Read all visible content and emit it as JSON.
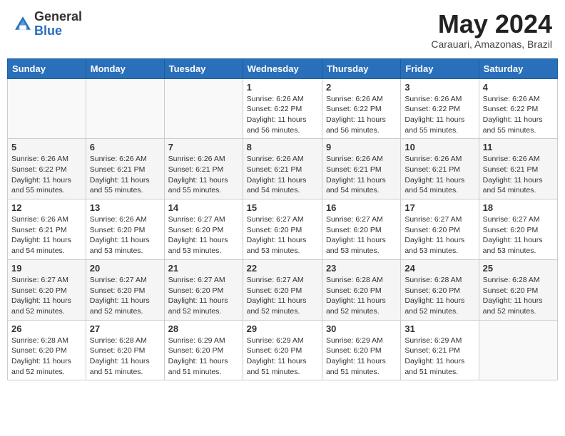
{
  "header": {
    "logo_general": "General",
    "logo_blue": "Blue",
    "month_title": "May 2024",
    "subtitle": "Carauari, Amazonas, Brazil"
  },
  "days_of_week": [
    "Sunday",
    "Monday",
    "Tuesday",
    "Wednesday",
    "Thursday",
    "Friday",
    "Saturday"
  ],
  "weeks": [
    [
      {
        "day": "",
        "sunrise": "",
        "sunset": "",
        "daylight": ""
      },
      {
        "day": "",
        "sunrise": "",
        "sunset": "",
        "daylight": ""
      },
      {
        "day": "",
        "sunrise": "",
        "sunset": "",
        "daylight": ""
      },
      {
        "day": "1",
        "sunrise": "Sunrise: 6:26 AM",
        "sunset": "Sunset: 6:22 PM",
        "daylight": "Daylight: 11 hours and 56 minutes."
      },
      {
        "day": "2",
        "sunrise": "Sunrise: 6:26 AM",
        "sunset": "Sunset: 6:22 PM",
        "daylight": "Daylight: 11 hours and 56 minutes."
      },
      {
        "day": "3",
        "sunrise": "Sunrise: 6:26 AM",
        "sunset": "Sunset: 6:22 PM",
        "daylight": "Daylight: 11 hours and 55 minutes."
      },
      {
        "day": "4",
        "sunrise": "Sunrise: 6:26 AM",
        "sunset": "Sunset: 6:22 PM",
        "daylight": "Daylight: 11 hours and 55 minutes."
      }
    ],
    [
      {
        "day": "5",
        "sunrise": "Sunrise: 6:26 AM",
        "sunset": "Sunset: 6:22 PM",
        "daylight": "Daylight: 11 hours and 55 minutes."
      },
      {
        "day": "6",
        "sunrise": "Sunrise: 6:26 AM",
        "sunset": "Sunset: 6:21 PM",
        "daylight": "Daylight: 11 hours and 55 minutes."
      },
      {
        "day": "7",
        "sunrise": "Sunrise: 6:26 AM",
        "sunset": "Sunset: 6:21 PM",
        "daylight": "Daylight: 11 hours and 55 minutes."
      },
      {
        "day": "8",
        "sunrise": "Sunrise: 6:26 AM",
        "sunset": "Sunset: 6:21 PM",
        "daylight": "Daylight: 11 hours and 54 minutes."
      },
      {
        "day": "9",
        "sunrise": "Sunrise: 6:26 AM",
        "sunset": "Sunset: 6:21 PM",
        "daylight": "Daylight: 11 hours and 54 minutes."
      },
      {
        "day": "10",
        "sunrise": "Sunrise: 6:26 AM",
        "sunset": "Sunset: 6:21 PM",
        "daylight": "Daylight: 11 hours and 54 minutes."
      },
      {
        "day": "11",
        "sunrise": "Sunrise: 6:26 AM",
        "sunset": "Sunset: 6:21 PM",
        "daylight": "Daylight: 11 hours and 54 minutes."
      }
    ],
    [
      {
        "day": "12",
        "sunrise": "Sunrise: 6:26 AM",
        "sunset": "Sunset: 6:21 PM",
        "daylight": "Daylight: 11 hours and 54 minutes."
      },
      {
        "day": "13",
        "sunrise": "Sunrise: 6:26 AM",
        "sunset": "Sunset: 6:20 PM",
        "daylight": "Daylight: 11 hours and 53 minutes."
      },
      {
        "day": "14",
        "sunrise": "Sunrise: 6:27 AM",
        "sunset": "Sunset: 6:20 PM",
        "daylight": "Daylight: 11 hours and 53 minutes."
      },
      {
        "day": "15",
        "sunrise": "Sunrise: 6:27 AM",
        "sunset": "Sunset: 6:20 PM",
        "daylight": "Daylight: 11 hours and 53 minutes."
      },
      {
        "day": "16",
        "sunrise": "Sunrise: 6:27 AM",
        "sunset": "Sunset: 6:20 PM",
        "daylight": "Daylight: 11 hours and 53 minutes."
      },
      {
        "day": "17",
        "sunrise": "Sunrise: 6:27 AM",
        "sunset": "Sunset: 6:20 PM",
        "daylight": "Daylight: 11 hours and 53 minutes."
      },
      {
        "day": "18",
        "sunrise": "Sunrise: 6:27 AM",
        "sunset": "Sunset: 6:20 PM",
        "daylight": "Daylight: 11 hours and 53 minutes."
      }
    ],
    [
      {
        "day": "19",
        "sunrise": "Sunrise: 6:27 AM",
        "sunset": "Sunset: 6:20 PM",
        "daylight": "Daylight: 11 hours and 52 minutes."
      },
      {
        "day": "20",
        "sunrise": "Sunrise: 6:27 AM",
        "sunset": "Sunset: 6:20 PM",
        "daylight": "Daylight: 11 hours and 52 minutes."
      },
      {
        "day": "21",
        "sunrise": "Sunrise: 6:27 AM",
        "sunset": "Sunset: 6:20 PM",
        "daylight": "Daylight: 11 hours and 52 minutes."
      },
      {
        "day": "22",
        "sunrise": "Sunrise: 6:27 AM",
        "sunset": "Sunset: 6:20 PM",
        "daylight": "Daylight: 11 hours and 52 minutes."
      },
      {
        "day": "23",
        "sunrise": "Sunrise: 6:28 AM",
        "sunset": "Sunset: 6:20 PM",
        "daylight": "Daylight: 11 hours and 52 minutes."
      },
      {
        "day": "24",
        "sunrise": "Sunrise: 6:28 AM",
        "sunset": "Sunset: 6:20 PM",
        "daylight": "Daylight: 11 hours and 52 minutes."
      },
      {
        "day": "25",
        "sunrise": "Sunrise: 6:28 AM",
        "sunset": "Sunset: 6:20 PM",
        "daylight": "Daylight: 11 hours and 52 minutes."
      }
    ],
    [
      {
        "day": "26",
        "sunrise": "Sunrise: 6:28 AM",
        "sunset": "Sunset: 6:20 PM",
        "daylight": "Daylight: 11 hours and 52 minutes."
      },
      {
        "day": "27",
        "sunrise": "Sunrise: 6:28 AM",
        "sunset": "Sunset: 6:20 PM",
        "daylight": "Daylight: 11 hours and 51 minutes."
      },
      {
        "day": "28",
        "sunrise": "Sunrise: 6:29 AM",
        "sunset": "Sunset: 6:20 PM",
        "daylight": "Daylight: 11 hours and 51 minutes."
      },
      {
        "day": "29",
        "sunrise": "Sunrise: 6:29 AM",
        "sunset": "Sunset: 6:20 PM",
        "daylight": "Daylight: 11 hours and 51 minutes."
      },
      {
        "day": "30",
        "sunrise": "Sunrise: 6:29 AM",
        "sunset": "Sunset: 6:20 PM",
        "daylight": "Daylight: 11 hours and 51 minutes."
      },
      {
        "day": "31",
        "sunrise": "Sunrise: 6:29 AM",
        "sunset": "Sunset: 6:21 PM",
        "daylight": "Daylight: 11 hours and 51 minutes."
      },
      {
        "day": "",
        "sunrise": "",
        "sunset": "",
        "daylight": ""
      }
    ]
  ]
}
